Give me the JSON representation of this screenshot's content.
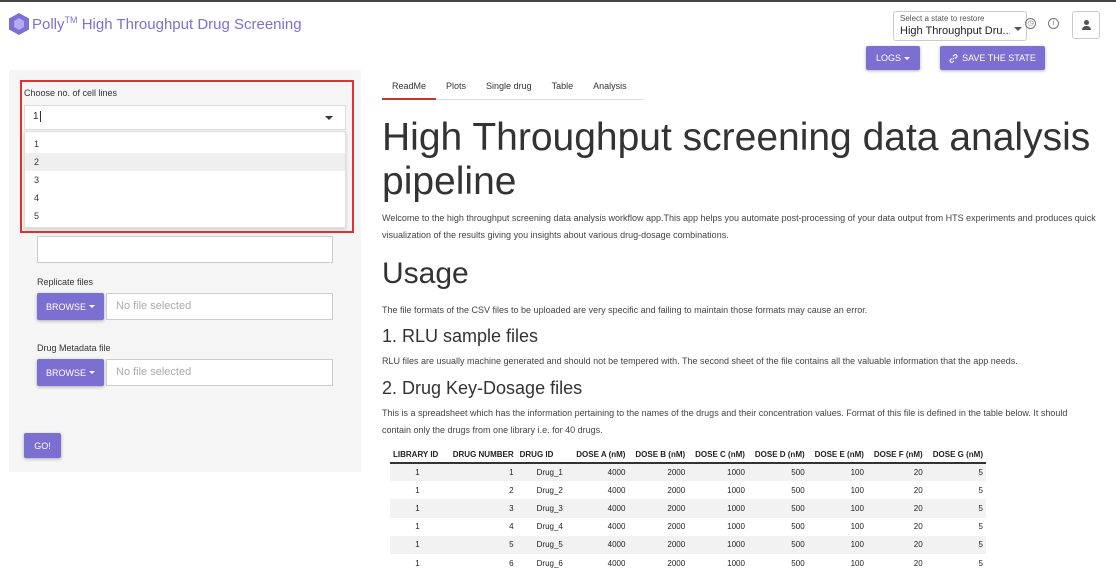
{
  "app": {
    "name": "Polly",
    "tm": "TM",
    "title": "High Throughput Drug Screening",
    "brand_color": "#7c6fd6"
  },
  "header": {
    "state_caption": "Select a state to restore",
    "state_value": "High Throughput Dru...",
    "logs_label": "LOGS",
    "save_label": "SAVE THE STATE"
  },
  "sidebar": {
    "cell_lines_label": "Choose no. of cell lines",
    "cell_lines_value": "1",
    "cell_lines_options": [
      "1",
      "2",
      "3",
      "4",
      "5"
    ],
    "replicate_label": "Replicate files",
    "metadata_label": "Drug Metadata file",
    "browse_label": "BROWSE",
    "no_file": "No file selected",
    "go_label": "GO!"
  },
  "tabs": [
    "ReadMe",
    "Plots",
    "Single drug",
    "Table",
    "Analysis"
  ],
  "readme": {
    "title": "High Throughput screening data analysis pipeline",
    "intro": "Welcome to the high throughput screening data analysis workflow app.This app helps you automate post-processing of your data output from HTS experiments and produces quick visualization of the results giving you insights about various drug-dosage combinations.",
    "usage_heading": "Usage",
    "usage_text": "The file formats of the CSV files to be uploaded are very specific and failing to maintain those formats may cause an error.",
    "rlu_heading": "1. RLU sample files",
    "rlu_text": "RLU files are usually machine generated and should not be tempered with. The second sheet of the file contains all the valuable information that the app needs.",
    "drug_heading": "2. Drug Key-Dosage files",
    "drug_text": "This is a spreadsheet which has the information pertaining to the names of the drugs and their concentration values. Format of this file is defined in the table below. It should contain only the drugs from one library i.e. for 40 drugs."
  },
  "table": {
    "headers": [
      "LIBRARY ID",
      "DRUG NUMBER",
      "DRUG ID",
      "DOSE A (nM)",
      "DOSE B (nM)",
      "DOSE C (nM)",
      "DOSE D (nM)",
      "DOSE E (nM)",
      "DOSE F (nM)",
      "DOSE G (nM)"
    ],
    "rows": [
      [
        "1",
        "1",
        "Drug_1",
        "4000",
        "2000",
        "1000",
        "500",
        "100",
        "20",
        "5"
      ],
      [
        "1",
        "2",
        "Drug_2",
        "4000",
        "2000",
        "1000",
        "500",
        "100",
        "20",
        "5"
      ],
      [
        "1",
        "3",
        "Drug_3",
        "4000",
        "2000",
        "1000",
        "500",
        "100",
        "20",
        "5"
      ],
      [
        "1",
        "4",
        "Drug_4",
        "4000",
        "2000",
        "1000",
        "500",
        "100",
        "20",
        "5"
      ],
      [
        "1",
        "5",
        "Drug_5",
        "4000",
        "2000",
        "1000",
        "500",
        "100",
        "20",
        "5"
      ],
      [
        "1",
        "6",
        "Drug_6",
        "4000",
        "2000",
        "1000",
        "500",
        "100",
        "20",
        "5"
      ]
    ]
  }
}
